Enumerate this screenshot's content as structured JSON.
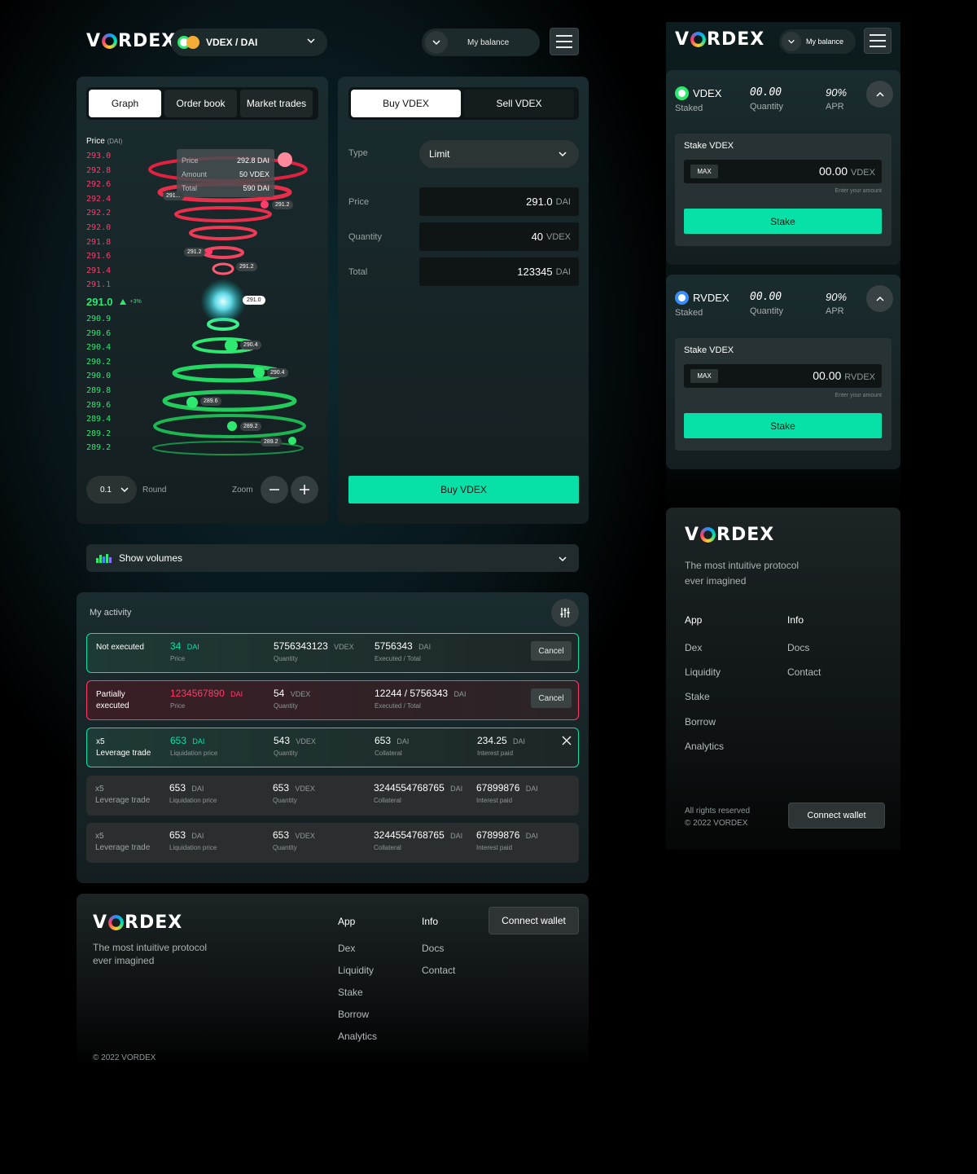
{
  "brand": {
    "logo_pre": "V",
    "logo_post": "RDEX"
  },
  "header": {
    "pair_label": "VDEX / DAI",
    "balance_label": "My balance"
  },
  "chart_tabs": [
    {
      "label": "Graph",
      "active": true
    },
    {
      "label": "Order book",
      "active": false
    },
    {
      "label": "Market trades",
      "active": false
    }
  ],
  "chart": {
    "price_label": "Price",
    "price_unit": "(DAI)",
    "asks": [
      "293.0",
      "292.8",
      "292.6",
      "292.4",
      "292.2",
      "292.0",
      "291.8",
      "291.6",
      "291.4",
      "291.1"
    ],
    "current": "291.0",
    "change": "+3%",
    "bids": [
      "290.9",
      "290.6",
      "290.4",
      "290.2",
      "290.0",
      "289.8",
      "289.6",
      "289.4",
      "289.2",
      "289.2"
    ],
    "tooltip": {
      "price_label": "Price",
      "price_value": "292.8 DAI",
      "amount_label": "Amount",
      "amount_value": "50 VDEX",
      "total_label": "Total",
      "total_value": "590 DAI"
    },
    "markers": [
      "291...",
      "291.2",
      "291.2",
      "291.2",
      "291.0",
      "290.4",
      "290.4",
      "289.6",
      "289.2",
      "289.2"
    ],
    "round_value": "0.1",
    "round_label": "Round",
    "zoom_label": "Zoom"
  },
  "order": {
    "tabs": [
      {
        "label": "Buy VDEX",
        "active": true
      },
      {
        "label": "Sell VDEX",
        "active": false
      }
    ],
    "type_label": "Type",
    "type_value": "Limit",
    "price_label": "Price",
    "price_value": "291.0",
    "price_unit": "DAI",
    "quantity_label": "Quantity",
    "quantity_value": "40",
    "quantity_unit": "VDEX",
    "total_label": "Total",
    "total_value": "123345",
    "total_unit": "DAI",
    "submit_label": "Buy VDEX"
  },
  "volumes": {
    "label": "Show volumes"
  },
  "activity": {
    "title": "My activity",
    "rows": [
      {
        "status": "Not executed",
        "v1": "34",
        "u1": "DAI",
        "s1": "Price",
        "v2": "5756343123",
        "u2": "VDEX",
        "s2": "Quantity",
        "v3": "5756343",
        "u3": "DAI",
        "s3": "Executed / Total",
        "action": "Cancel"
      },
      {
        "status": "Partially executed",
        "v1": "1234567890",
        "u1": "DAI",
        "s1": "Price",
        "v2": "54",
        "u2": "VDEX",
        "s2": "Quantity",
        "v3": "12244 / 5756343",
        "u3": "DAI",
        "s3": "Executed / Total",
        "action": "Cancel"
      },
      {
        "status_a": "x5",
        "status_b": "Leverage trade",
        "v1": "653",
        "u1": "DAI",
        "s1": "Liquidation price",
        "v2": "543",
        "u2": "VDEX",
        "s2": "Quantity",
        "v3": "653",
        "u3": "DAI",
        "s3": "Collateral",
        "v4": "234.25",
        "u4": "DAI",
        "s4": "Interest paid"
      },
      {
        "status_a": "x5",
        "status_b": "Leverage trade",
        "v1": "653",
        "u1": "DAI",
        "s1": "Liquidation price",
        "v2": "653",
        "u2": "VDEX",
        "s2": "Quantity",
        "v3": "3244554768765",
        "u3": "DAI",
        "s3": "Collateral",
        "v4": "67899876",
        "u4": "DAI",
        "s4": "Interest paid"
      },
      {
        "status_a": "x5",
        "status_b": "Leverage trade",
        "v1": "653",
        "u1": "DAI",
        "s1": "Liquidation price",
        "v2": "653",
        "u2": "VDEX",
        "s2": "Quantity",
        "v3": "3244554768765",
        "u3": "DAI",
        "s3": "Collateral",
        "v4": "67899876",
        "u4": "DAI",
        "s4": "Interest paid"
      }
    ]
  },
  "footer": {
    "tagline_1": "The most intuitive protocol",
    "tagline_2": "ever imagined",
    "app_heading": "App",
    "app_links": [
      "Dex",
      "Liquidity",
      "Stake",
      "Borrow",
      "Analytics"
    ],
    "info_heading": "Info",
    "info_links": [
      "Docs",
      "Contact"
    ],
    "connect_label": "Connect wallet",
    "copyright": "© 2022 VORDEX",
    "rights": "All rights reserved"
  },
  "staking": [
    {
      "token": "VDEX",
      "staked_label": "Staked",
      "qty": "00.00",
      "qty_label": "Quantity",
      "apr": "90%",
      "apr_label": "APR",
      "form_title": "Stake VDEX",
      "max_label": "MAX",
      "amount": "00.00",
      "amount_unit": "VDEX",
      "hint": "Enter your amount",
      "button": "Stake"
    },
    {
      "token": "RVDEX",
      "staked_label": "Staked",
      "qty": "00.00",
      "qty_label": "Quantity",
      "apr": "90%",
      "apr_label": "APR",
      "form_title": "Stake VDEX",
      "max_label": "MAX",
      "amount": "00.00",
      "amount_unit": "RVDEX",
      "hint": "Enter your amount",
      "button": "Stake"
    }
  ],
  "colors": {
    "accent": "#07e1a8",
    "ask": "#ff3b6b",
    "bid": "#2ee870"
  }
}
